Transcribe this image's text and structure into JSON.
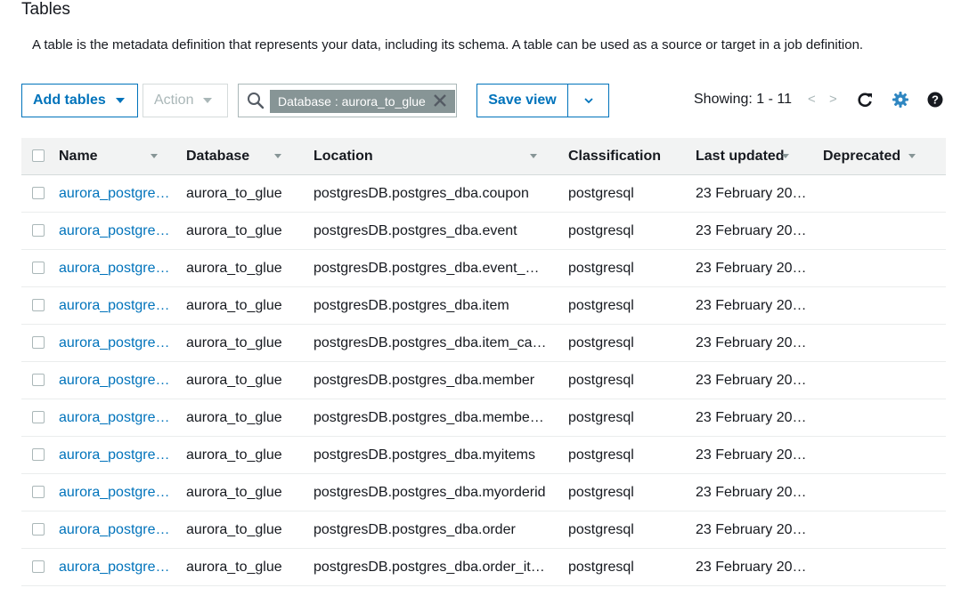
{
  "page": {
    "title": "Tables",
    "description": "A table is the metadata definition that represents your data, including its schema. A table can be used as a source or target in a job definition."
  },
  "toolbar": {
    "add_tables": "Add tables",
    "action": "Action",
    "filter_token": "Database : aurora_to_glue",
    "save_view": "Save view",
    "showing": "Showing: 1 - 11",
    "prev": "<",
    "next": ">"
  },
  "table": {
    "columns": [
      "Name",
      "Database",
      "Location",
      "Classification",
      "Last updated",
      "Deprecated"
    ],
    "rows": [
      {
        "name": "aurora_postgre…",
        "database": "aurora_to_glue",
        "location": "postgresDB.postgres_dba.coupon",
        "classification": "postgresql",
        "updated": "23 February 20…",
        "deprecated": ""
      },
      {
        "name": "aurora_postgre…",
        "database": "aurora_to_glue",
        "location": "postgresDB.postgres_dba.event",
        "classification": "postgresql",
        "updated": "23 February 20…",
        "deprecated": ""
      },
      {
        "name": "aurora_postgre…",
        "database": "aurora_to_glue",
        "location": "postgresDB.postgres_dba.event_…",
        "classification": "postgresql",
        "updated": "23 February 20…",
        "deprecated": ""
      },
      {
        "name": "aurora_postgre…",
        "database": "aurora_to_glue",
        "location": "postgresDB.postgres_dba.item",
        "classification": "postgresql",
        "updated": "23 February 20…",
        "deprecated": ""
      },
      {
        "name": "aurora_postgre…",
        "database": "aurora_to_glue",
        "location": "postgresDB.postgres_dba.item_ca…",
        "classification": "postgresql",
        "updated": "23 February 20…",
        "deprecated": ""
      },
      {
        "name": "aurora_postgre…",
        "database": "aurora_to_glue",
        "location": "postgresDB.postgres_dba.member",
        "classification": "postgresql",
        "updated": "23 February 20…",
        "deprecated": ""
      },
      {
        "name": "aurora_postgre…",
        "database": "aurora_to_glue",
        "location": "postgresDB.postgres_dba.membe…",
        "classification": "postgresql",
        "updated": "23 February 20…",
        "deprecated": ""
      },
      {
        "name": "aurora_postgre…",
        "database": "aurora_to_glue",
        "location": "postgresDB.postgres_dba.myitems",
        "classification": "postgresql",
        "updated": "23 February 20…",
        "deprecated": ""
      },
      {
        "name": "aurora_postgre…",
        "database": "aurora_to_glue",
        "location": "postgresDB.postgres_dba.myorderid",
        "classification": "postgresql",
        "updated": "23 February 20…",
        "deprecated": ""
      },
      {
        "name": "aurora_postgre…",
        "database": "aurora_to_glue",
        "location": "postgresDB.postgres_dba.order",
        "classification": "postgresql",
        "updated": "23 February 20…",
        "deprecated": ""
      },
      {
        "name": "aurora_postgre…",
        "database": "aurora_to_glue",
        "location": "postgresDB.postgres_dba.order_it…",
        "classification": "postgresql",
        "updated": "23 February 20…",
        "deprecated": ""
      }
    ]
  },
  "icons": {
    "search": "search-icon",
    "clear": "close-icon",
    "refresh": "refresh-icon",
    "settings": "gear-icon",
    "help": "help-icon"
  },
  "colors": {
    "accent": "#0073bb",
    "token_bg": "#879596",
    "header_bg": "#f2f3f3",
    "settings_icon": "#2e86c1"
  }
}
